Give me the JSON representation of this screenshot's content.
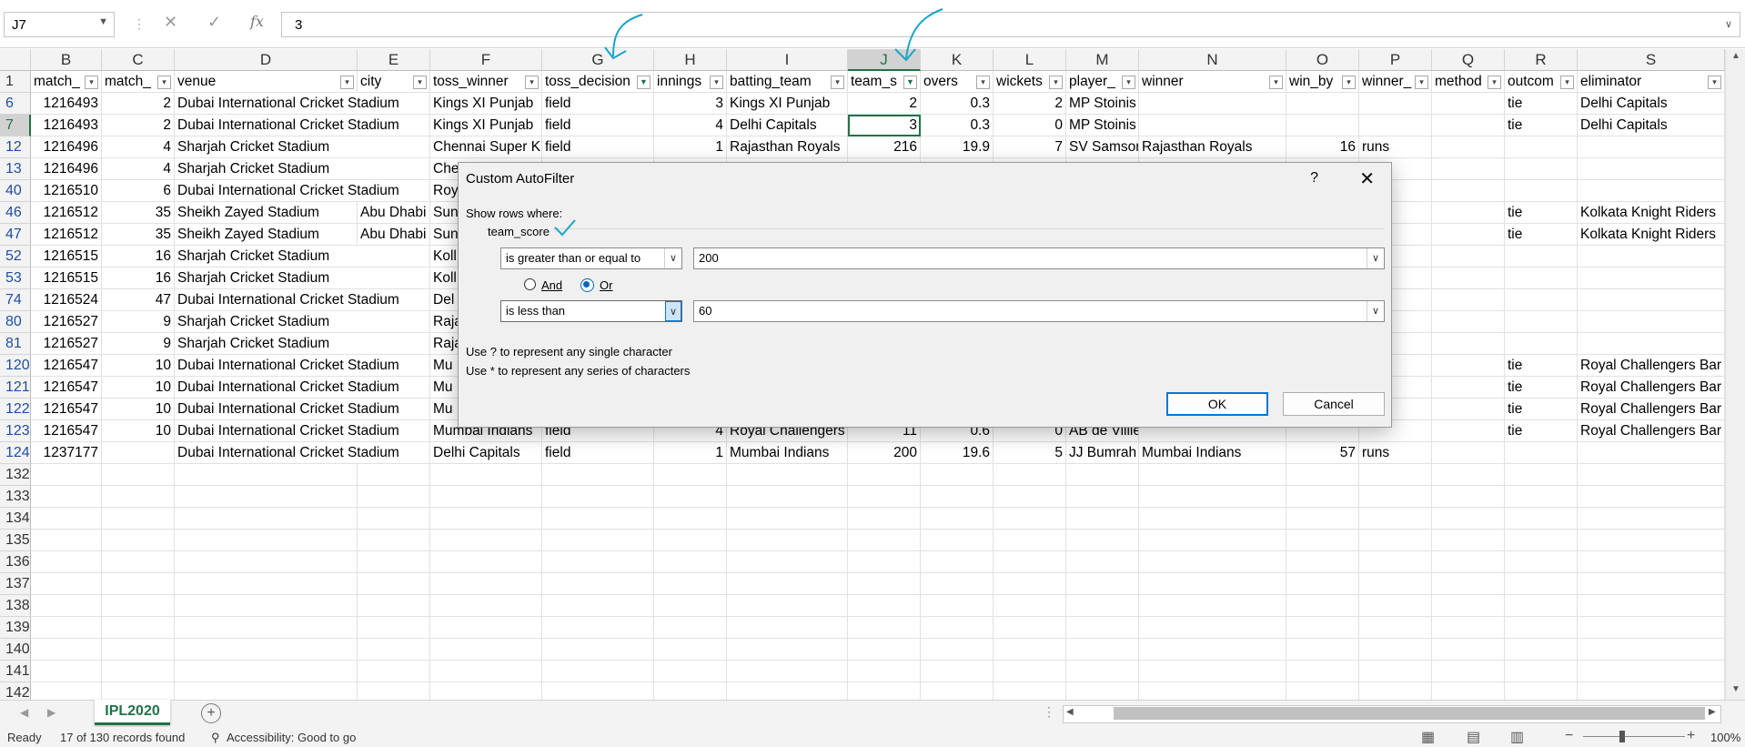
{
  "formula_bar": {
    "name_box": "J7",
    "cancel_icon": "✕",
    "enter_icon": "✓",
    "fx": "fx",
    "value": "3"
  },
  "columns": [
    {
      "letter": "B",
      "header": "match_",
      "filter": "none"
    },
    {
      "letter": "C",
      "header": "match_",
      "filter": "none"
    },
    {
      "letter": "D",
      "header": "venue",
      "filter": "none"
    },
    {
      "letter": "E",
      "header": "city",
      "filter": "none"
    },
    {
      "letter": "F",
      "header": "toss_winner",
      "filter": "none"
    },
    {
      "letter": "G",
      "header": "toss_decision",
      "filter": "active"
    },
    {
      "letter": "H",
      "header": "innings",
      "filter": "none"
    },
    {
      "letter": "I",
      "header": "batting_team",
      "filter": "none"
    },
    {
      "letter": "J",
      "header": "team_s",
      "filter": "active"
    },
    {
      "letter": "K",
      "header": "overs",
      "filter": "none"
    },
    {
      "letter": "L",
      "header": "wickets",
      "filter": "none"
    },
    {
      "letter": "M",
      "header": "player_",
      "filter": "none"
    },
    {
      "letter": "N",
      "header": "winner",
      "filter": "none"
    },
    {
      "letter": "O",
      "header": "win_by",
      "filter": "none"
    },
    {
      "letter": "P",
      "header": "winner_",
      "filter": "none"
    },
    {
      "letter": "Q",
      "header": "method",
      "filter": "none"
    },
    {
      "letter": "R",
      "header": "outcom",
      "filter": "none"
    },
    {
      "letter": "S",
      "header": "eliminator",
      "filter": "none"
    }
  ],
  "header_row_number": "1",
  "rows": [
    {
      "num": "6",
      "B": "1216493",
      "C": "2",
      "D": "Dubai International Cricket Stadium",
      "E": "",
      "F": "Kings XI Punjab",
      "G": "field",
      "H": "3",
      "I": "Kings XI Punjab",
      "J": "2",
      "K": "0.3",
      "L": "2",
      "M": "MP Stoinis",
      "N": "",
      "O": "",
      "P": "",
      "Q": "",
      "R": "tie",
      "S": "Delhi Capitals"
    },
    {
      "num": "7",
      "B": "1216493",
      "C": "2",
      "D": "Dubai International Cricket Stadium",
      "E": "",
      "F": "Kings XI Punjab",
      "G": "field",
      "H": "4",
      "I": "Delhi Capitals",
      "J": "3",
      "K": "0.3",
      "L": "0",
      "M": "MP Stoinis",
      "N": "",
      "O": "",
      "P": "",
      "Q": "",
      "R": "tie",
      "S": "Delhi Capitals"
    },
    {
      "num": "12",
      "B": "1216496",
      "C": "4",
      "D": "Sharjah Cricket Stadium",
      "E": "",
      "F": "Chennai Super Kings",
      "G": "field",
      "H": "1",
      "I": "Rajasthan Royals",
      "J": "216",
      "K": "19.9",
      "L": "7",
      "M": "SV Samson",
      "N": "Rajasthan Royals",
      "O": "16",
      "P": "runs",
      "Q": "",
      "R": "",
      "S": ""
    },
    {
      "num": "13",
      "B": "1216496",
      "C": "4",
      "D": "Sharjah Cricket Stadium",
      "E": "",
      "F": "Che",
      "G": "",
      "H": "",
      "I": "",
      "J": "",
      "K": "",
      "L": "",
      "M": "",
      "N": "",
      "O": "",
      "P": "",
      "Q": "",
      "R": "",
      "S": ""
    },
    {
      "num": "40",
      "B": "1216510",
      "C": "6",
      "D": "Dubai International Cricket Stadium",
      "E": "",
      "F": "Roy",
      "G": "",
      "H": "",
      "I": "",
      "J": "",
      "K": "",
      "L": "",
      "M": "",
      "N": "",
      "O": "",
      "P": "",
      "Q": "",
      "R": "",
      "S": ""
    },
    {
      "num": "46",
      "B": "1216512",
      "C": "35",
      "D": "Sheikh Zayed Stadium",
      "E": "Abu Dhabi",
      "F": "Sun",
      "G": "",
      "H": "",
      "I": "",
      "J": "",
      "K": "",
      "L": "",
      "M": "",
      "N": "",
      "O": "",
      "P": "",
      "Q": "",
      "R": "tie",
      "S": "Kolkata Knight Riders"
    },
    {
      "num": "47",
      "B": "1216512",
      "C": "35",
      "D": "Sheikh Zayed Stadium",
      "E": "Abu Dhabi",
      "F": "Sun",
      "G": "",
      "H": "",
      "I": "",
      "J": "",
      "K": "",
      "L": "",
      "M": "",
      "N": "",
      "O": "",
      "P": "",
      "Q": "",
      "R": "tie",
      "S": "Kolkata Knight Riders"
    },
    {
      "num": "52",
      "B": "1216515",
      "C": "16",
      "D": "Sharjah Cricket Stadium",
      "E": "",
      "F": "Koll",
      "G": "",
      "H": "",
      "I": "",
      "J": "",
      "K": "",
      "L": "",
      "M": "",
      "N": "",
      "O": "",
      "P": "",
      "Q": "",
      "R": "",
      "S": ""
    },
    {
      "num": "53",
      "B": "1216515",
      "C": "16",
      "D": "Sharjah Cricket Stadium",
      "E": "",
      "F": "Koll",
      "G": "",
      "H": "",
      "I": "",
      "J": "",
      "K": "",
      "L": "",
      "M": "",
      "N": "",
      "O": "",
      "P": "",
      "Q": "",
      "R": "",
      "S": ""
    },
    {
      "num": "74",
      "B": "1216524",
      "C": "47",
      "D": "Dubai International Cricket Stadium",
      "E": "",
      "F": "Del",
      "G": "",
      "H": "",
      "I": "",
      "J": "",
      "K": "",
      "L": "",
      "M": "",
      "N": "",
      "O": "",
      "P": "",
      "Q": "",
      "R": "",
      "S": ""
    },
    {
      "num": "80",
      "B": "1216527",
      "C": "9",
      "D": "Sharjah Cricket Stadium",
      "E": "",
      "F": "Raja",
      "G": "",
      "H": "",
      "I": "",
      "J": "",
      "K": "",
      "L": "",
      "M": "",
      "N": "",
      "O": "",
      "P": "ets",
      "Q": "",
      "R": "",
      "S": ""
    },
    {
      "num": "81",
      "B": "1216527",
      "C": "9",
      "D": "Sharjah Cricket Stadium",
      "E": "",
      "F": "Raja",
      "G": "",
      "H": "",
      "I": "",
      "J": "",
      "K": "",
      "L": "",
      "M": "",
      "N": "",
      "O": "",
      "P": "ets",
      "Q": "",
      "R": "",
      "S": ""
    },
    {
      "num": "120",
      "B": "1216547",
      "C": "10",
      "D": "Dubai International Cricket Stadium",
      "E": "",
      "F": "Mu",
      "G": "",
      "H": "",
      "I": "",
      "J": "",
      "K": "",
      "L": "",
      "M": "",
      "N": "",
      "O": "",
      "P": "",
      "Q": "",
      "R": "tie",
      "S": "Royal Challengers Bar"
    },
    {
      "num": "121",
      "B": "1216547",
      "C": "10",
      "D": "Dubai International Cricket Stadium",
      "E": "",
      "F": "Mu",
      "G": "",
      "H": "",
      "I": "",
      "J": "",
      "K": "",
      "L": "",
      "M": "",
      "N": "",
      "O": "",
      "P": "",
      "Q": "",
      "R": "tie",
      "S": "Royal Challengers Bar"
    },
    {
      "num": "122",
      "B": "1216547",
      "C": "10",
      "D": "Dubai International Cricket Stadium",
      "E": "",
      "F": "Mu",
      "G": "",
      "H": "",
      "I": "",
      "J": "",
      "K": "",
      "L": "",
      "M": "",
      "N": "",
      "O": "",
      "P": "",
      "Q": "",
      "R": "tie",
      "S": "Royal Challengers Bar"
    },
    {
      "num": "123",
      "B": "1216547",
      "C": "10",
      "D": "Dubai International Cricket Stadium",
      "E": "",
      "F": "Mumbai Indians",
      "G": "field",
      "H": "4",
      "I": "Royal Challengers",
      "J": "11",
      "K": "0.6",
      "L": "0",
      "M": "AB de Villiers",
      "N": "",
      "O": "",
      "P": "",
      "Q": "",
      "R": "tie",
      "S": "Royal Challengers Bar"
    },
    {
      "num": "124",
      "B": "1237177",
      "C": "",
      "D": "Dubai International Cricket Stadium",
      "E": "",
      "F": "Delhi Capitals",
      "G": "field",
      "H": "1",
      "I": "Mumbai Indians",
      "J": "200",
      "K": "19.6",
      "L": "5",
      "M": "JJ Bumrah",
      "N": "Mumbai Indians",
      "O": "57",
      "P": "runs",
      "Q": "",
      "R": "",
      "S": ""
    }
  ],
  "empty_rows": [
    "132",
    "133",
    "134",
    "135",
    "136",
    "137",
    "138",
    "139",
    "140",
    "141",
    "142"
  ],
  "active_cell": {
    "row": "7",
    "col": "J"
  },
  "sheet_tab": "IPL2020",
  "status": {
    "ready": "Ready",
    "records": "17 of 130 records found",
    "accessibility": "Accessibility: Good to go",
    "zoom": "100%"
  },
  "dialog": {
    "title": "Custom AutoFilter",
    "help": "?",
    "close": "✕",
    "show_rows_where": "Show rows where:",
    "field": "team_score",
    "op1": "is greater than or equal to",
    "val1": "200",
    "and_label": "And",
    "or_label": "Or",
    "logic": "Or",
    "op2": "is less than",
    "val2": "60",
    "hint1": "Use ? to represent any single character",
    "hint2": "Use * to represent any series of characters",
    "ok": "OK",
    "cancel": "Cancel"
  },
  "accent_color": "#217346"
}
